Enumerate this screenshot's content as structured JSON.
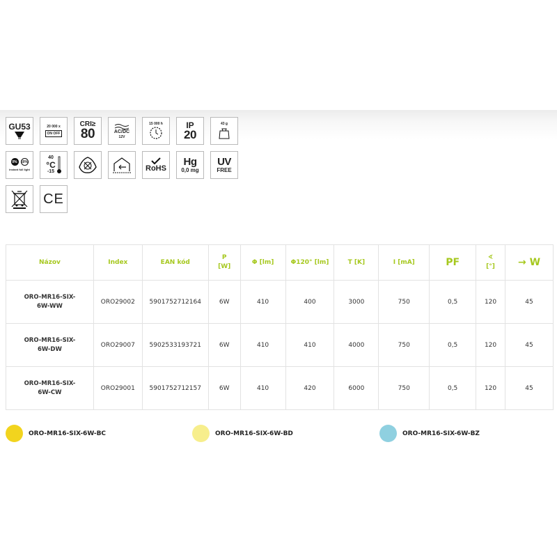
{
  "icons": {
    "row1": [
      {
        "name": "gu53-socket-icon",
        "text": [
          "GU53"
        ]
      },
      {
        "name": "switch-cycles-icon",
        "text": [
          "20 000 x",
          "ON OFF"
        ]
      },
      {
        "name": "cri-icon",
        "text": [
          "CRI≥",
          "80"
        ]
      },
      {
        "name": "acdc-icon",
        "text": [
          "AC/DC",
          "12V"
        ]
      },
      {
        "name": "lifetime-icon",
        "text": [
          "15 000 h"
        ]
      },
      {
        "name": "ip-rating-icon",
        "text": [
          "IP",
          "20"
        ]
      },
      {
        "name": "weight-icon",
        "text": [
          "43 g"
        ]
      }
    ],
    "row2": [
      {
        "name": "instant-light-icon",
        "text": [
          "0%",
          "60%",
          "instant full light"
        ]
      },
      {
        "name": "temperature-icon",
        "text": [
          "40",
          "°C",
          "-15"
        ]
      },
      {
        "name": "not-dimmable-icon",
        "text": []
      },
      {
        "name": "indoor-icon",
        "text": []
      },
      {
        "name": "rohs-icon",
        "text": [
          "RoHS"
        ]
      },
      {
        "name": "mercury-icon",
        "text": [
          "Hg",
          "0,0 mg"
        ]
      },
      {
        "name": "uv-free-icon",
        "text": [
          "UV",
          "FREE"
        ]
      }
    ],
    "row3": [
      {
        "name": "weee-bin-icon",
        "text": []
      },
      {
        "name": "ce-mark-icon",
        "text": [
          "CE"
        ]
      }
    ]
  },
  "table": {
    "headers": [
      "Názov",
      "Index",
      "EAN kód",
      "P\n[W]",
      "Φ [lm]",
      "Φ120° [lm]",
      "T [K]",
      "I [mA]",
      "PF",
      "∢\n[°]",
      "→ W"
    ],
    "rows": [
      [
        "ORO-MR16-SIX-6W-WW",
        "ORO29002",
        "5901752712164",
        "6W",
        "410",
        "400",
        "3000",
        "750",
        "0,5",
        "120",
        "45"
      ],
      [
        "ORO-MR16-SIX-6W-DW",
        "ORO29007",
        "5902533193721",
        "6W",
        "410",
        "410",
        "4000",
        "750",
        "0,5",
        "120",
        "45"
      ],
      [
        "ORO-MR16-SIX-6W-CW",
        "ORO29001",
        "5901752712157",
        "6W",
        "410",
        "420",
        "6000",
        "750",
        "0,5",
        "120",
        "45"
      ]
    ]
  },
  "variants": [
    {
      "label": "ORO-MR16-SIX-6W-BC",
      "color": "#f2d41e"
    },
    {
      "label": "ORO-MR16-SIX-6W-BD",
      "color": "#f7ee8c"
    },
    {
      "label": "ORO-MR16-SIX-6W-BZ",
      "color": "#8fd0e0"
    }
  ],
  "colors": {
    "accent": "#a6c81e"
  }
}
